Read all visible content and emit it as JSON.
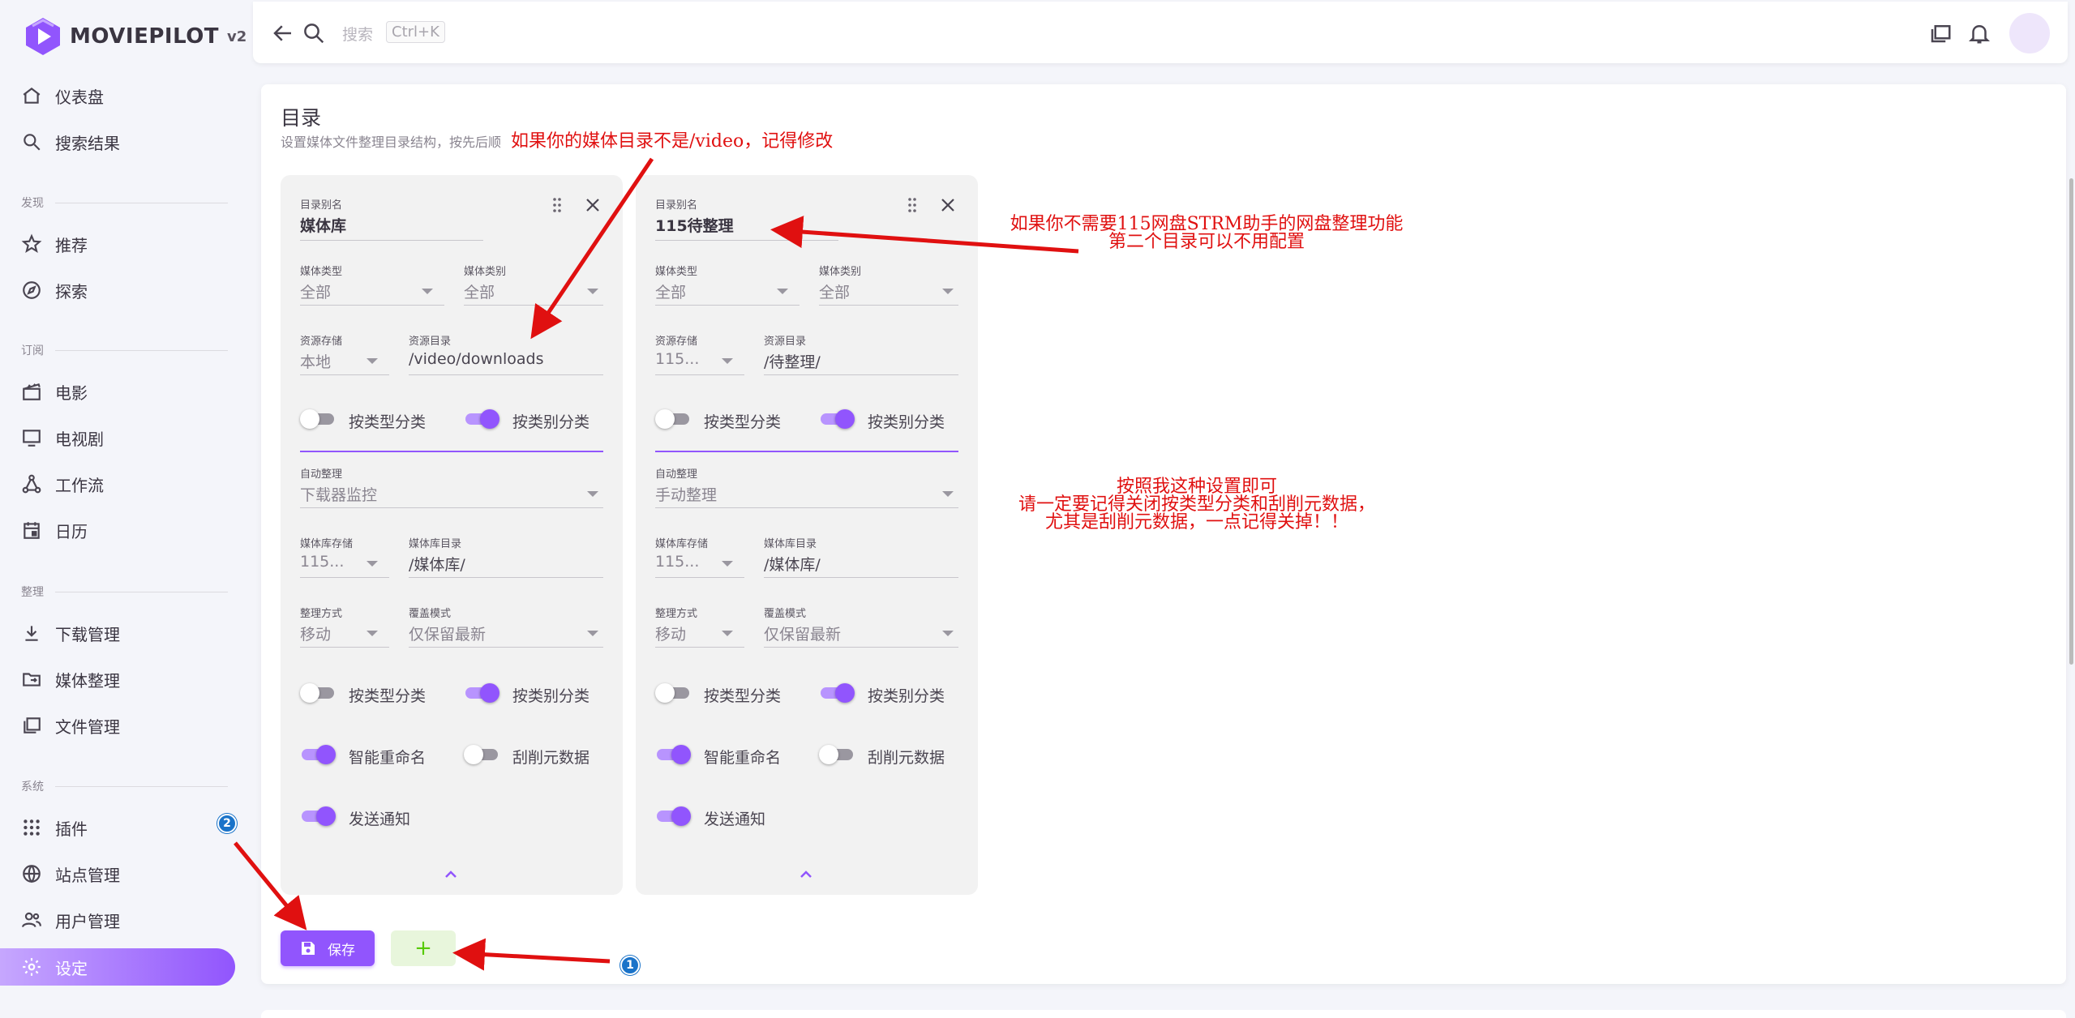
{
  "brand": {
    "name": "MOVIEPILOT",
    "version": "v2"
  },
  "sidebar": {
    "items": [
      {
        "label": "仪表盘"
      },
      {
        "label": "搜索结果"
      },
      {
        "label": "推荐"
      },
      {
        "label": "探索"
      },
      {
        "label": "电影"
      },
      {
        "label": "电视剧"
      },
      {
        "label": "工作流"
      },
      {
        "label": "日历"
      },
      {
        "label": "下载管理"
      },
      {
        "label": "媒体整理"
      },
      {
        "label": "文件管理"
      },
      {
        "label": "插件"
      },
      {
        "label": "站点管理"
      },
      {
        "label": "用户管理"
      },
      {
        "label": "设定"
      }
    ],
    "sections": {
      "discover": "发现",
      "subscribe": "订阅",
      "organize": "整理",
      "system": "系统"
    },
    "plugin_badge": "2"
  },
  "topbar": {
    "search_label": "搜索",
    "shortcut": "Ctrl+K"
  },
  "main": {
    "title": "目录",
    "subtitle": "设置媒体文件整理目录结构，按先后顺"
  },
  "labels": {
    "alias": "目录别名",
    "media_type": "媒体类型",
    "media_category": "媒体类别",
    "resource_storage": "资源存储",
    "resource_dir": "资源目录",
    "by_type": "按类型分类",
    "by_category": "按类别分类",
    "auto_organize": "自动整理",
    "library_storage": "媒体库存储",
    "library_dir": "媒体库目录",
    "organize_method": "整理方式",
    "overwrite_mode": "覆盖模式",
    "smart_rename": "智能重命名",
    "scrape_meta": "刮削元数据",
    "send_notify": "发送通知"
  },
  "cards": [
    {
      "alias": "媒体库",
      "media_type": "全部",
      "media_category": "全部",
      "resource_storage": "本地",
      "resource_dir": "/video/downloads",
      "res_by_type": false,
      "res_by_category": true,
      "auto_organize": "下载器监控",
      "library_storage": "115...",
      "library_dir": "/媒体库/",
      "organize_method": "移动",
      "overwrite_mode": "仅保留最新",
      "lib_by_type": false,
      "lib_by_category": true,
      "smart_rename": true,
      "scrape_meta": false,
      "send_notify": true
    },
    {
      "alias": "115待整理",
      "media_type": "全部",
      "media_category": "全部",
      "resource_storage": "115...",
      "resource_dir": "/待整理/",
      "res_by_type": false,
      "res_by_category": true,
      "auto_organize": "手动整理",
      "library_storage": "115...",
      "library_dir": "/媒体库/",
      "organize_method": "移动",
      "overwrite_mode": "仅保留最新",
      "lib_by_type": false,
      "lib_by_category": true,
      "smart_rename": true,
      "scrape_meta": false,
      "send_notify": true
    }
  ],
  "buttons": {
    "save": "保存",
    "add": "+"
  },
  "annotations": {
    "a1": "如果你的媒体目录不是/video，记得修改",
    "a2_line1": "如果你不需要115网盘STRM助手的网盘整理功能",
    "a2_line2": "第二个目录可以不用配置",
    "a3_line1": "按照我这种设置即可",
    "a3_line2": "请一定要记得关闭按类型分类和刮削元数据，",
    "a3_line3": "尤其是刮削元数据，一点记得关掉！！",
    "badge1": "1",
    "badge2": "2"
  },
  "colors": {
    "primary": "#9155fd",
    "annotation": "#e01010",
    "add_button_bg": "#e8f6dc",
    "add_button_fg": "#56ca00"
  }
}
